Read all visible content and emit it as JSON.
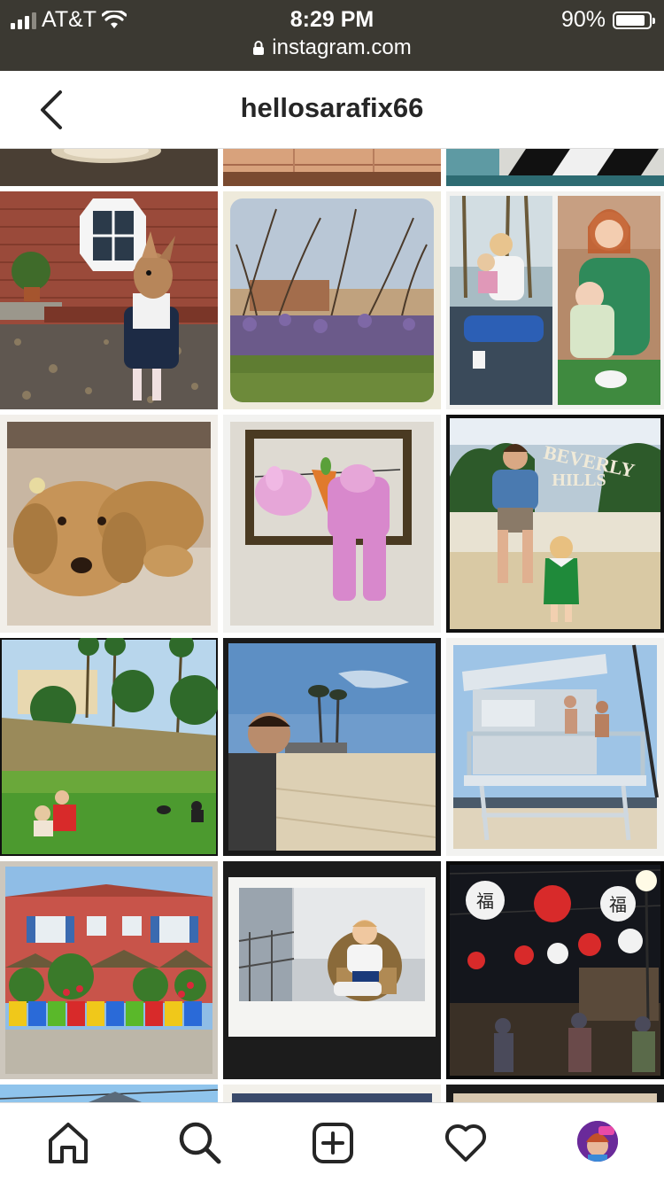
{
  "status_bar": {
    "carrier": "AT&T",
    "time": "8:29 PM",
    "battery": "90%",
    "battery_level": 0.9,
    "url": "instagram.com"
  },
  "header": {
    "title": "hellosarafix66"
  },
  "grid": {
    "captions": {
      "beverly_sign": "BEVERLY HILLS",
      "lantern_char": "福"
    }
  },
  "icons": {
    "back": "chevron-left-icon",
    "home": "home-icon",
    "search": "search-icon",
    "add": "add-post-icon",
    "activity": "heart-icon"
  },
  "colors": {
    "status_bg": "#3b3932",
    "header_text": "#262626",
    "divider": "#dbdbdb"
  }
}
